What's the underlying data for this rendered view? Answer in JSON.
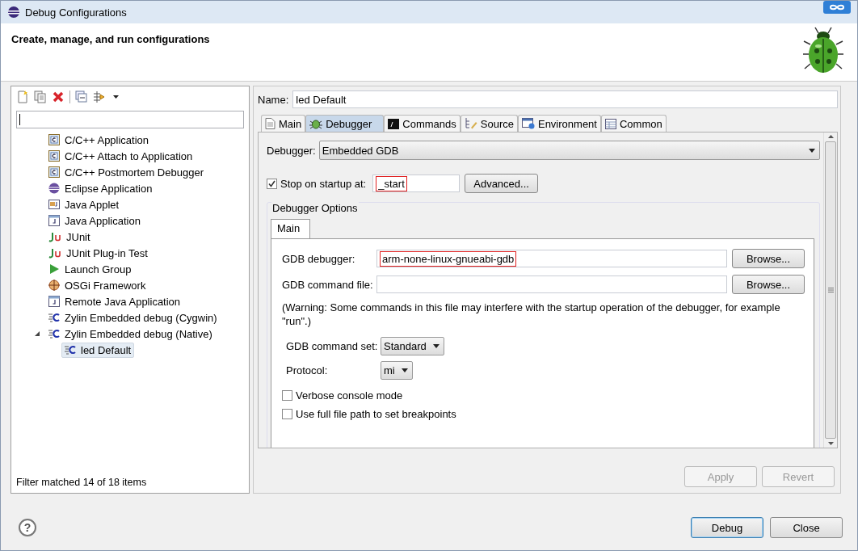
{
  "window": {
    "title": "Debug Configurations"
  },
  "header": {
    "title": "Create, manage, and run configurations"
  },
  "tree": [
    {
      "label": "C/C++ Application",
      "kind": "c",
      "selected": false
    },
    {
      "label": "C/C++ Attach to Application",
      "kind": "c",
      "selected": false
    },
    {
      "label": "C/C++ Postmortem Debugger",
      "kind": "c",
      "selected": false
    },
    {
      "label": "Eclipse Application",
      "kind": "eclipse",
      "selected": false
    },
    {
      "label": "Java Applet",
      "kind": "applet",
      "selected": false
    },
    {
      "label": "Java Application",
      "kind": "java",
      "selected": false
    },
    {
      "label": "JUnit",
      "kind": "junit",
      "selected": false
    },
    {
      "label": "JUnit Plug-in Test",
      "kind": "junit",
      "selected": false
    },
    {
      "label": "Launch Group",
      "kind": "launch",
      "selected": false
    },
    {
      "label": "OSGi Framework",
      "kind": "osgi",
      "selected": false
    },
    {
      "label": "Remote Java Application",
      "kind": "java",
      "selected": false
    },
    {
      "label": "Zylin Embedded debug (Cygwin)",
      "kind": "zylin",
      "selected": false
    },
    {
      "label": "Zylin Embedded debug (Native)",
      "kind": "zylin",
      "selected": false,
      "expanded": true,
      "children": [
        {
          "label": "led Default",
          "kind": "zylin",
          "selected": true
        }
      ]
    }
  ],
  "filter_status": "Filter matched 14 of 18 items",
  "name": {
    "label": "Name:",
    "value": "led Default"
  },
  "tabs": [
    {
      "label": "Main",
      "kind": "doc",
      "selected": false
    },
    {
      "label": "Debugger",
      "kind": "bug",
      "selected": true
    },
    {
      "label": "Commands",
      "kind": "console",
      "selected": false
    },
    {
      "label": "Source",
      "kind": "source",
      "selected": false
    },
    {
      "label": "Environment",
      "kind": "env",
      "selected": false
    },
    {
      "label": "Common",
      "kind": "table",
      "selected": false
    }
  ],
  "debugger": {
    "label": "Debugger:",
    "value": "Embedded GDB"
  },
  "stop_on_startup": {
    "label": "Stop on startup at:",
    "checked": true,
    "value": "_start",
    "highlighted": true
  },
  "advanced_button": "Advanced...",
  "options": {
    "title": "Debugger Options",
    "tabs": [
      {
        "label": "Main",
        "selected": true
      }
    ],
    "fields": [
      {
        "label": "GDB debugger:",
        "value": "arm-none-linux-gnueabi-gdb",
        "highlighted": true,
        "button": "Browse..."
      },
      {
        "label": "GDB command file:",
        "button": "Browse..."
      }
    ],
    "warning": "(Warning: Some commands in this file may interfere with the startup operation of the debugger, for example \"run\".)",
    "selects": [
      {
        "label": "GDB command set:",
        "value": "Standard"
      },
      {
        "label": "Protocol:",
        "value": "mi"
      }
    ],
    "checkboxes": [
      {
        "label": "Verbose console mode",
        "checked": false
      },
      {
        "label": "Use full file path to set breakpoints",
        "checked": false
      }
    ]
  },
  "apply_button": {
    "label": "Apply",
    "disabled": true
  },
  "revert_button": {
    "label": "Revert",
    "disabled": true
  },
  "help_button": "?",
  "buttons": [
    {
      "label": "Debug",
      "default": true
    },
    {
      "label": "Close",
      "default": false
    }
  ]
}
